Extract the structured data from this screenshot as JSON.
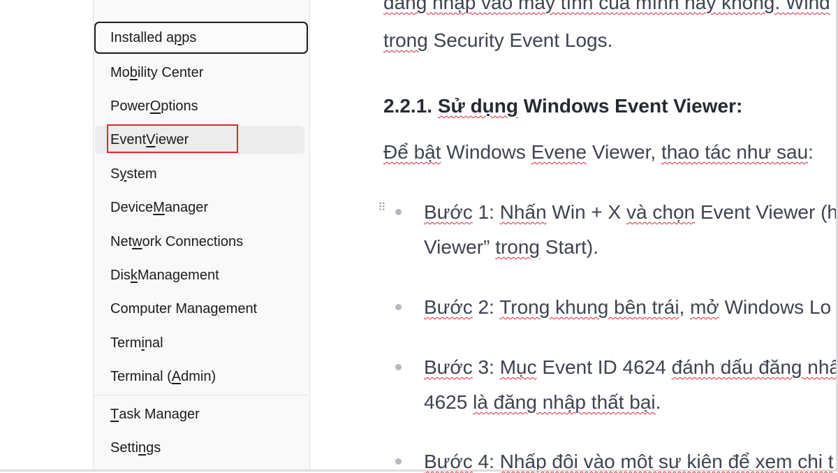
{
  "menu": {
    "items": [
      {
        "label_pre": "Installed a",
        "accel": "p",
        "label_post": "ps",
        "state": "focused"
      },
      {
        "label_pre": "Mo",
        "accel": "b",
        "label_post": "ility Center"
      },
      {
        "label_pre": "Power ",
        "accel": "O",
        "label_post": "ptions"
      },
      {
        "label_pre": "Event ",
        "accel": "V",
        "label_post": "iewer",
        "state": "hover-highlighted"
      },
      {
        "label_pre": "S",
        "accel": "y",
        "label_post": "stem"
      },
      {
        "label_pre": "Device ",
        "accel": "M",
        "label_post": "anager"
      },
      {
        "label_pre": "Net",
        "accel": "w",
        "label_post": "ork Connections"
      },
      {
        "label_pre": "Dis",
        "accel": "k",
        "label_post": " Management"
      },
      {
        "label_pre": "Computer Mana",
        "accel": "g",
        "label_post": "ement"
      },
      {
        "label_pre": "Term",
        "accel": "i",
        "label_post": "nal"
      },
      {
        "label_pre": "Terminal (",
        "accel": "A",
        "label_post": "dmin)"
      },
      {
        "label_pre": "",
        "accel": "T",
        "label_post": "ask Manager"
      },
      {
        "label_pre": "Setti",
        "accel": "n",
        "label_post": "gs"
      }
    ]
  },
  "article": {
    "line1_a": "đăng nhập vào máy tính của mình hay không. Wind",
    "line2_a": "trong",
    "line2_b": " Security Event Logs.",
    "heading_a": "2.2.1. ",
    "heading_b": "Sử dụng",
    "heading_c": " Windows Event Viewer:",
    "intro_a": "Để bật",
    "intro_b": " Windows ",
    "intro_c": "Evene",
    "intro_d": " Viewer, ",
    "intro_e": "thao tác như sau",
    "intro_f": ":",
    "s1_a": "Bước",
    "s1_b": " 1: ",
    "s1_c": "Nhấn",
    "s1_d": " Win + X ",
    "s1_e": "và chọn",
    "s1_f": " Event Viewer (h",
    "s1_g": "Viewer” ",
    "s1_h": "trong",
    "s1_i": " Start).",
    "s2_a": "Bước",
    "s2_b": " 2: ",
    "s2_c": "Trong khung bên trái",
    "s2_d": ", ",
    "s2_e": "mở",
    "s2_f": " Windows Lo",
    "s3_a": "Bước",
    "s3_b": " 3: ",
    "s3_c": "Mục",
    "s3_d": " Event ID 4624 ",
    "s3_e": "đánh dấu đăng nhấ",
    "s3_f": "4625 ",
    "s3_g": "là đăng nhập thất bại",
    "s3_h": ".",
    "s4_a": "Bước",
    "s4_b": " 4: ",
    "s4_c": "Nhấp đôi vào một sự kiện để xem chi t"
  }
}
